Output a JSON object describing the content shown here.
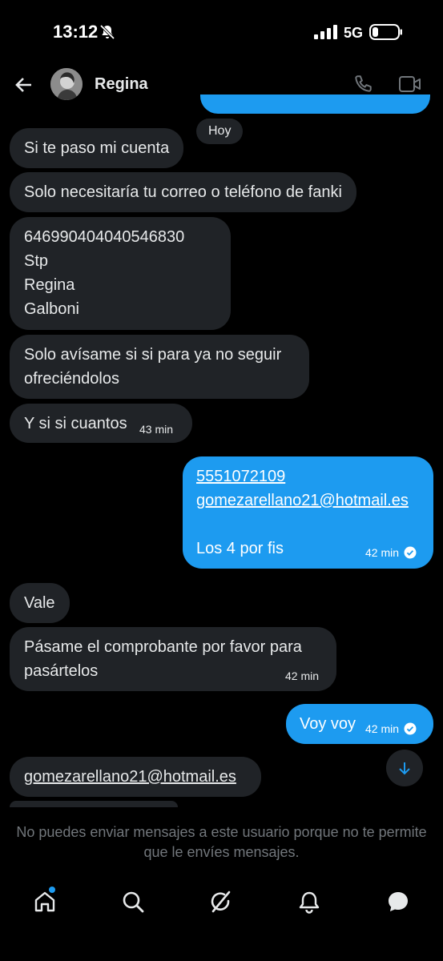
{
  "status_bar": {
    "time": "13:12",
    "network": "5G"
  },
  "header": {
    "contact_name": "Regina"
  },
  "date_separator": "Hoy",
  "messages": [
    {
      "direction": "in",
      "lines": [
        "Si te paso mi cuenta"
      ]
    },
    {
      "direction": "in",
      "lines": [
        "Solo necesitaría tu correo o teléfono de fanki"
      ]
    },
    {
      "direction": "in",
      "lines": [
        "646990404040546830",
        "Stp",
        "Regina",
        "Galboni"
      ]
    },
    {
      "direction": "in",
      "lines": [
        "Solo avísame si si para ya no seguir",
        "ofreciéndolos"
      ]
    },
    {
      "direction": "in",
      "lines": [
        "Y si si cuantos"
      ],
      "time": "43 min"
    },
    {
      "direction": "out",
      "lines": [
        "5551072109",
        "gomezarellano21@hotmail.es",
        "Los 4 por fis"
      ],
      "time": "42 min"
    },
    {
      "direction": "in",
      "lines": [
        "Vale"
      ]
    },
    {
      "direction": "in",
      "lines": [
        "Pásame el comprobante por favor para",
        "pasártelos"
      ],
      "time": "42 min"
    },
    {
      "direction": "out",
      "lines": [
        "Voy voy"
      ],
      "time": "42 min"
    },
    {
      "direction": "in",
      "lines": [
        "gomezarellano21@hotmail.es"
      ]
    }
  ],
  "notice": "No puedes enviar mensajes a este usuario porque no te permite que le envíes mensajes.",
  "colors": {
    "background": "#000000",
    "incoming": "#202327",
    "outgoing": "#1d9bf0",
    "muted": "#71767b"
  },
  "icons": {
    "back": "arrow-left-icon",
    "call": "phone-icon",
    "video": "video-icon",
    "scroll": "arrow-down-icon",
    "tabs": [
      "home-icon",
      "search-icon",
      "grok-icon",
      "bell-icon",
      "messages-icon"
    ]
  }
}
